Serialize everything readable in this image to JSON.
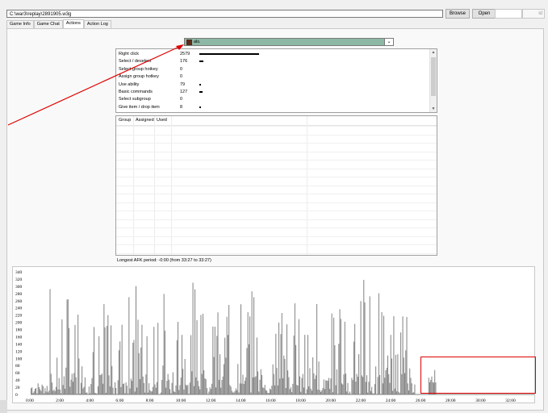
{
  "file": {
    "path": "C:\\war3\\replay\\2891905.w3g",
    "browse_label": "Browse",
    "open_label": "Open",
    "extra_label": "id"
  },
  "tabs": [
    {
      "label": "Game Info",
      "active": false
    },
    {
      "label": "Game Chat",
      "active": false
    },
    {
      "label": "Actions",
      "active": true
    },
    {
      "label": "Action Log",
      "active": false
    }
  ],
  "player": {
    "name": "als.",
    "dropdown_icon": "chevron-down-icon"
  },
  "actions": [
    {
      "label": "Right click",
      "count": "2579",
      "bar": 1.0
    },
    {
      "label": "Select / deselect",
      "count": "176",
      "bar": 0.068
    },
    {
      "label": "Select group hotkey",
      "count": "0",
      "bar": 0
    },
    {
      "label": "Assign group hotkey",
      "count": "0",
      "bar": 0
    },
    {
      "label": "Use ability",
      "count": "79",
      "bar": 0.031
    },
    {
      "label": "Basic commands",
      "count": "127",
      "bar": 0.049
    },
    {
      "label": "Select subgroup",
      "count": "0",
      "bar": 0
    },
    {
      "label": "Give item / drop item",
      "count": "8",
      "bar": 0.003
    }
  ],
  "hotkeys": {
    "columns": [
      "Group",
      "Assigned",
      "Used"
    ]
  },
  "afk_text": "Longest AFK period: -0:00 (from 33:27 to 33:27)",
  "chart_data": {
    "type": "bar",
    "y_ticks": [
      "340",
      "320",
      "300",
      "280",
      "260",
      "240",
      "220",
      "200",
      "180",
      "160",
      "140",
      "120",
      "100",
      "80",
      "60",
      "40",
      "20",
      "0"
    ],
    "x_ticks": [
      "0:00",
      "2:00",
      "4:00",
      "6:00",
      "8:00",
      "10:00",
      "12:00",
      "14:00",
      "16:00",
      "18:00",
      "20:00",
      "22:00",
      "24:00",
      "26:00",
      "28:00",
      "30:00",
      "32:00"
    ],
    "ylim": [
      0,
      340
    ],
    "bar_color": "#808080",
    "active_minutes": [
      [
        0,
        25.6
      ],
      [
        26.5,
        27.0
      ]
    ]
  },
  "annotation": {
    "color": "#e00000"
  }
}
